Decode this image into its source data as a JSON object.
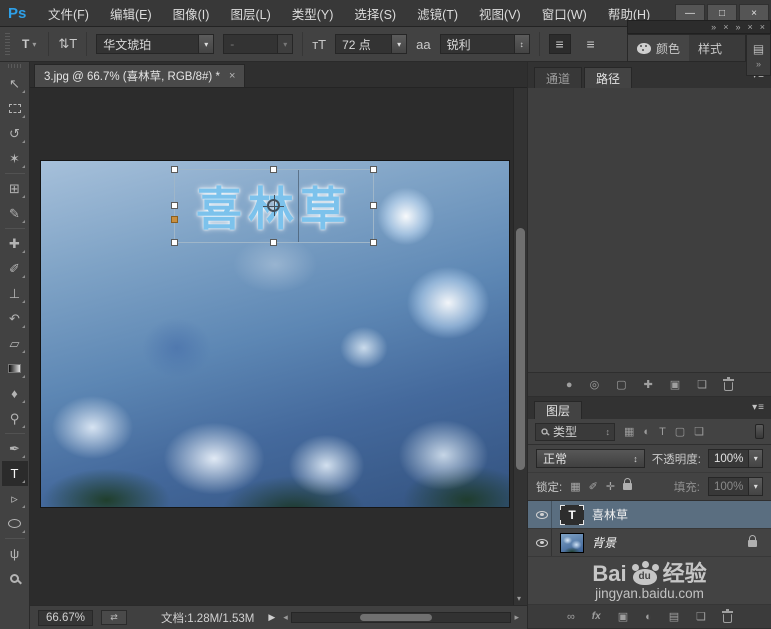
{
  "colors": {
    "accent_blue": "#2ea0e8",
    "selected_layer_bg": "#5a6e80",
    "canvas_text_blue": "#7cc2ec",
    "transform_anchor_orange": "#c98f3f",
    "panel_bg": "#434343"
  },
  "titlebar": {
    "logo": "Ps",
    "menus": [
      "文件(F)",
      "编辑(E)",
      "图像(I)",
      "图层(L)",
      "类型(Y)",
      "选择(S)",
      "滤镜(T)",
      "视图(V)",
      "窗口(W)",
      "帮助(H)"
    ],
    "window": {
      "minimize": "—",
      "maximize": "□",
      "close": "×"
    }
  },
  "panel_bar": {
    "chevrons": "»",
    "close": "×"
  },
  "options_bar": {
    "tool_icon": "T",
    "orientation_icon": "⇅T",
    "font_family": "华文琥珀",
    "font_style": "-",
    "size_icon": "тT",
    "font_size": "72 点",
    "aa_icon": "aa",
    "anti_alias": "锐利",
    "align_icon": "≡"
  },
  "float_panel": {
    "tabs": [
      "颜色",
      "样式"
    ]
  },
  "mini_dock": {
    "panel_icon": "▤"
  },
  "doc_tab": {
    "title": "3.jpg @ 66.7% (喜林草, RGB/8#) *",
    "close": "×"
  },
  "tools": [
    {
      "name": "move-tool",
      "glyph": "↖"
    },
    {
      "name": "rectangular-marquee-tool",
      "glyph": ""
    },
    {
      "name": "lasso-tool",
      "glyph": "↺"
    },
    {
      "name": "magic-wand-tool",
      "glyph": "✶"
    },
    {
      "name": "crop-tool",
      "glyph": "⊞"
    },
    {
      "name": "eyedropper-tool",
      "glyph": "✎"
    },
    {
      "name": "healing-brush-tool",
      "glyph": "✚"
    },
    {
      "name": "brush-tool",
      "glyph": "✐"
    },
    {
      "name": "clone-stamp-tool",
      "glyph": "⊥"
    },
    {
      "name": "history-brush-tool",
      "glyph": "↶"
    },
    {
      "name": "eraser-tool",
      "glyph": "▱"
    },
    {
      "name": "gradient-tool",
      "glyph": ""
    },
    {
      "name": "blur-tool",
      "glyph": "♦"
    },
    {
      "name": "dodge-tool",
      "glyph": "⚲"
    },
    {
      "name": "pen-tool",
      "glyph": "✒"
    },
    {
      "name": "type-tool",
      "glyph": "T"
    },
    {
      "name": "path-selection-tool",
      "glyph": "▹"
    },
    {
      "name": "ellipse-tool",
      "glyph": ""
    },
    {
      "name": "hand-tool",
      "glyph": "ψ"
    },
    {
      "name": "zoom-tool",
      "glyph": ""
    }
  ],
  "canvas": {
    "text": "喜林草"
  },
  "dock": {
    "tabs": {
      "channels": "通道",
      "paths": "路径",
      "menu": "▾≡"
    },
    "paths_footer": [
      {
        "name": "fill-path",
        "glyph": "●"
      },
      {
        "name": "stroke-path",
        "glyph": "◎"
      },
      {
        "name": "load-path-selection",
        "glyph": "▢"
      },
      {
        "name": "make-work-path",
        "glyph": "✚"
      },
      {
        "name": "add-mask",
        "glyph": "▣"
      },
      {
        "name": "new-path",
        "glyph": "❏"
      }
    ],
    "layers": {
      "tab": "图层",
      "menu": "▾≡",
      "filter": {
        "label": "类型",
        "icons": {
          "pixel": "▦",
          "adjustment": "◐",
          "type": "T",
          "shape": "▢",
          "smart_object": "❏"
        }
      },
      "blend_mode": "正常",
      "opacity_label": "不透明度:",
      "opacity_value": "100%",
      "lock_label": "锁定:",
      "lock_icons": {
        "transparency": "▦",
        "pixels": "✐",
        "position": "✛"
      },
      "fill_label": "填充:",
      "fill_value": "100%",
      "rows": [
        {
          "name": "喜林草",
          "thumb_glyph": "T"
        },
        {
          "name": "背景"
        }
      ],
      "footer": {
        "link": "∞",
        "fx": "fx",
        "mask": "▣",
        "adjustment": "◐",
        "group": "▤",
        "new_layer": "❏"
      }
    }
  },
  "status_bar": {
    "zoom": "66.67%",
    "mini_icon": "⇄",
    "doc_info": "文档:1.28M/1.53M",
    "flyout": "▶",
    "left_arrow": "◂",
    "right_arrow": "▸",
    "down_arrow": "▾"
  },
  "watermark": {
    "bai": "Bai",
    "du": "du",
    "jingyan": "经验",
    "url": "jingyan.baidu.com"
  },
  "glyphs": {
    "caret": "▾",
    "updown": "↕"
  }
}
